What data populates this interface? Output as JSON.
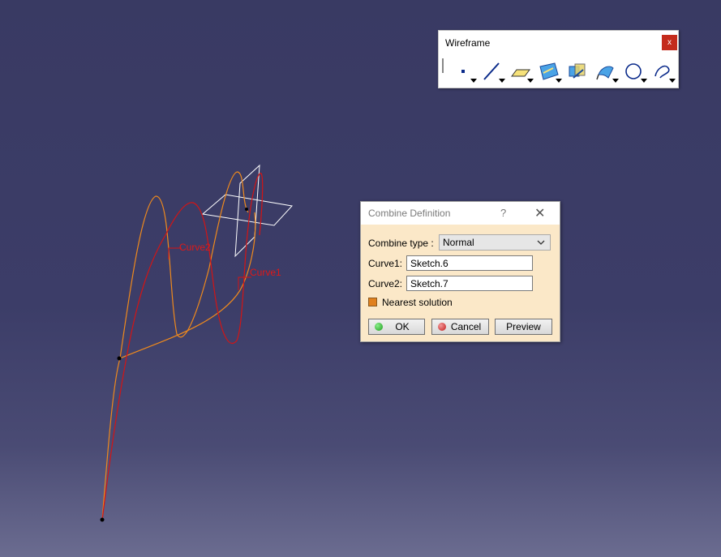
{
  "viewport": {
    "curve_labels": [
      "Curve2",
      "Curve1"
    ]
  },
  "toolbar": {
    "title": "Wireframe",
    "close_label": "x",
    "tools": [
      "point-icon",
      "line-icon",
      "plane-icon",
      "projection-icon",
      "intersection-icon",
      "offset-icon",
      "circle-icon",
      "spline-icon"
    ]
  },
  "dialog": {
    "title": "Combine Definition",
    "help_label": "?",
    "close_label": "✕",
    "combine_type_label": "Combine type :",
    "combine_type_value": "Normal",
    "curve1_label": "Curve1:",
    "curve1_value": "Sketch.6",
    "curve2_label": "Curve2:",
    "curve2_value": "Sketch.7",
    "nearest_label": "Nearest solution",
    "nearest_checked": true,
    "ok_label": "OK",
    "cancel_label": "Cancel",
    "preview_label": "Preview"
  },
  "colors": {
    "orange_curve": "#f08a1c",
    "red_curve": "#d41414",
    "plane_outline": "#ffffff"
  }
}
